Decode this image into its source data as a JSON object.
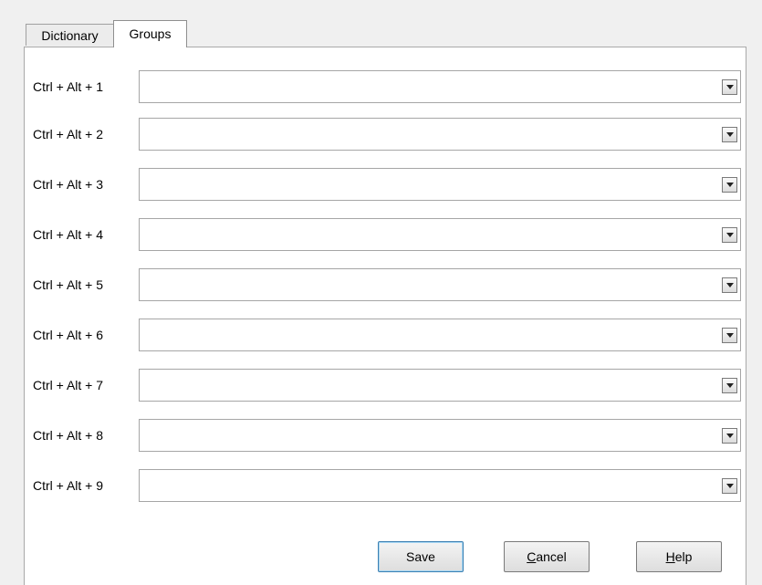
{
  "tabs": [
    {
      "label": "Dictionary",
      "active": false
    },
    {
      "label": "Groups",
      "active": true
    }
  ],
  "rows": [
    {
      "label": "Ctrl + Alt + 1",
      "value": ""
    },
    {
      "label": "Ctrl + Alt + 2",
      "value": ""
    },
    {
      "label": "Ctrl + Alt + 3",
      "value": ""
    },
    {
      "label": "Ctrl + Alt + 4",
      "value": ""
    },
    {
      "label": "Ctrl + Alt + 5",
      "value": ""
    },
    {
      "label": "Ctrl + Alt + 6",
      "value": ""
    },
    {
      "label": "Ctrl + Alt + 7",
      "value": ""
    },
    {
      "label": "Ctrl + Alt + 8",
      "value": ""
    },
    {
      "label": "Ctrl + Alt + 9",
      "value": ""
    }
  ],
  "buttons": {
    "save": {
      "label": "Save"
    },
    "cancel": {
      "label": "Cancel",
      "mnemonic": "C",
      "rest": "ancel"
    },
    "help": {
      "label": "Help",
      "mnemonic": "H",
      "rest": "elp"
    }
  },
  "icons": {
    "dropdown": "chevron-down-icon"
  },
  "colors": {
    "default_button_border": "#3c7fb1"
  }
}
